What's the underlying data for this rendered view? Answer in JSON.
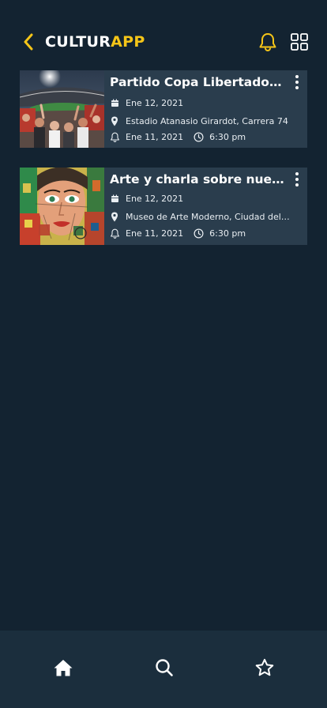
{
  "app": {
    "brand_part1": "CULTUR",
    "brand_part2": "APP",
    "accent_color": "#f5c518",
    "background_color": "#132331",
    "card_color": "#2a3d4d"
  },
  "header": {
    "back_icon": "chevron-left-icon",
    "notifications_icon": "bell-icon",
    "view_toggle_icon": "grid-view-icon"
  },
  "events": [
    {
      "title": "Partido Copa Libertadores",
      "date": "Ene 12, 2021",
      "place": "Estadio Atanasio Girardot, Carrera 74",
      "reminder_date": "Ene 11, 2021",
      "reminder_time": "6:30 pm",
      "image": "stadium-crowd-photo"
    },
    {
      "title": "Arte y charla sobre nuevas...",
      "date": "Ene 12, 2021",
      "place": "Museo de Arte Moderno, Ciudad del Rio...",
      "reminder_date": "Ene 11, 2021",
      "reminder_time": "6:30 pm",
      "image": "street-art-face-mural"
    }
  ],
  "bottom_nav": [
    {
      "id": "home",
      "icon": "home-icon"
    },
    {
      "id": "search",
      "icon": "search-icon"
    },
    {
      "id": "favorites",
      "icon": "star-icon"
    }
  ]
}
